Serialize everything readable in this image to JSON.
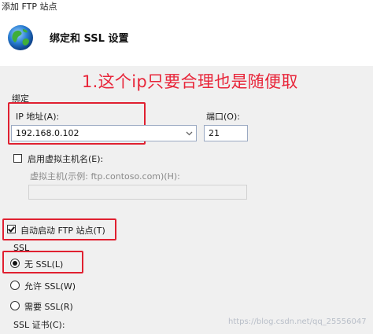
{
  "window": {
    "title": "添加 FTP 站点"
  },
  "header": {
    "title": "绑定和 SSL 设置",
    "icon": "globe-icon"
  },
  "annotation": {
    "text": "1.这个ip只要合理也是随便取",
    "color": "#e8263a"
  },
  "binding": {
    "group_label": "绑定",
    "ip_label": "IP 地址(A):",
    "ip_value": "192.168.0.102",
    "port_label": "端口(O):",
    "port_value": "21",
    "virtual_host_checkbox": "启用虚拟主机名(E):",
    "virtual_host_label": "虚拟主机(示例: ftp.contoso.com)(H):",
    "virtual_host_value": ""
  },
  "autostart": {
    "label": "自动启动 FTP 站点(T)",
    "checked": true
  },
  "ssl": {
    "group_label": "SSL",
    "options": [
      {
        "label": "无 SSL(L)",
        "selected": true
      },
      {
        "label": "允许 SSL(W)",
        "selected": false
      },
      {
        "label": "需要 SSL(R)",
        "selected": false
      }
    ],
    "cert_label": "SSL 证书(C):"
  },
  "watermark": "https://blog.csdn.net/qq_25556047"
}
